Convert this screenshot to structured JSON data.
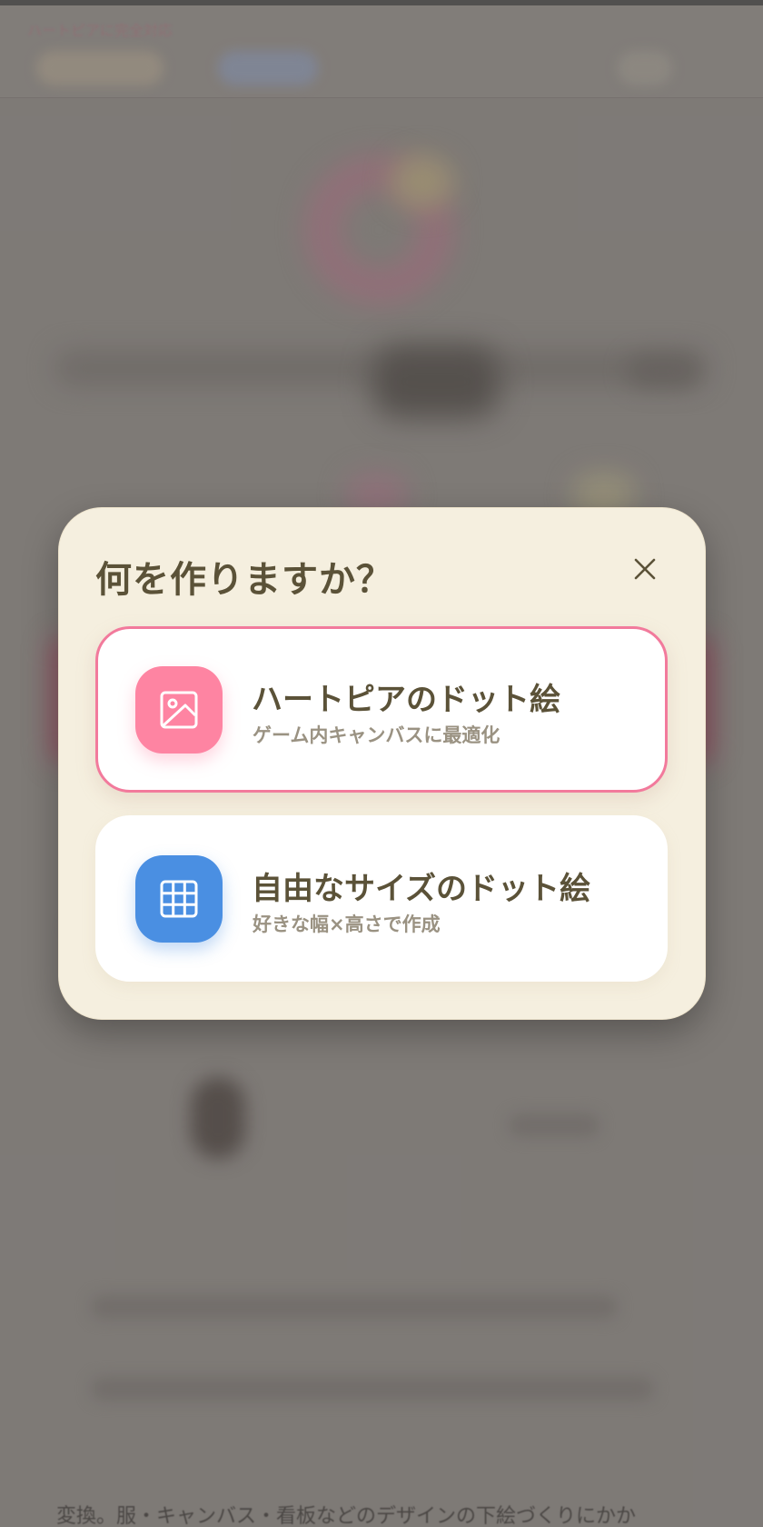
{
  "background": {
    "notice": "ハートピアに完全対応",
    "footer_text": "変換。服・キャンバス・看板などのデザインの下絵づくりにかか"
  },
  "modal": {
    "title": "何を作りますか？",
    "close_icon": "close-icon",
    "options": [
      {
        "title": "ハートピアのドット絵",
        "subtitle": "ゲーム内キャンバスに最適化",
        "icon": "image-icon",
        "icon_color": "#fe84a2",
        "selected": true
      },
      {
        "title": "自由なサイズのドット絵",
        "subtitle": "好きな幅×高さで作成",
        "icon": "grid-icon",
        "icon_color": "#4a8fe2",
        "selected": false
      }
    ]
  },
  "colors": {
    "accent_pink": "#f27a9c",
    "text_dark": "#5b5238",
    "text_muted": "#9a9282",
    "modal_bg": "#f5efdf"
  }
}
